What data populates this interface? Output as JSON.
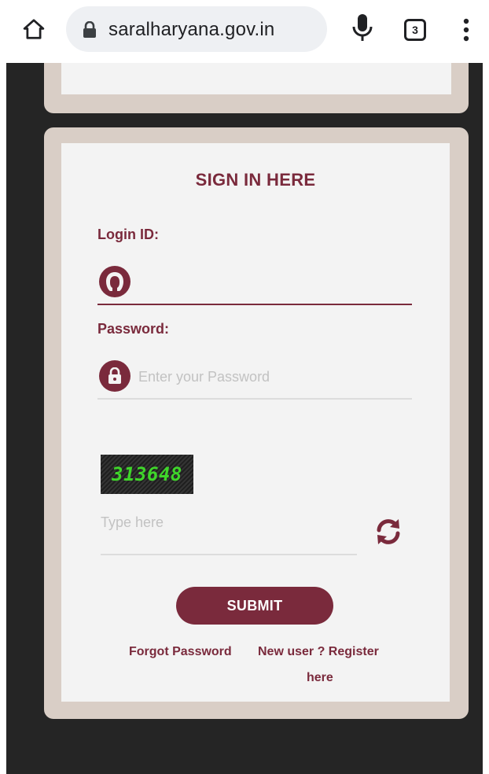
{
  "browser": {
    "url": "saralharyana.gov.in",
    "tab_count": "3"
  },
  "signin": {
    "title": "SIGN IN HERE",
    "login_label": "Login ID:",
    "login_value": "",
    "password_label": "Password:",
    "password_placeholder": "Enter your Password",
    "captcha_text": "313648",
    "captcha_placeholder": "Type here",
    "submit_label": "SUBMIT",
    "forgot_label": "Forgot Password",
    "register_line1": "New user ? Register",
    "register_line2": "here"
  },
  "colors": {
    "brand": "#7a2a3c",
    "card_border": "#d9cec6",
    "page_bg": "#252525",
    "captcha_text": "#3fd62a"
  },
  "icons": {
    "home": "home-icon",
    "lock": "lock-icon",
    "mic": "mic-icon",
    "menu": "more-vert-icon",
    "user": "user-icon",
    "password": "padlock-icon",
    "refresh": "refresh-icon"
  }
}
